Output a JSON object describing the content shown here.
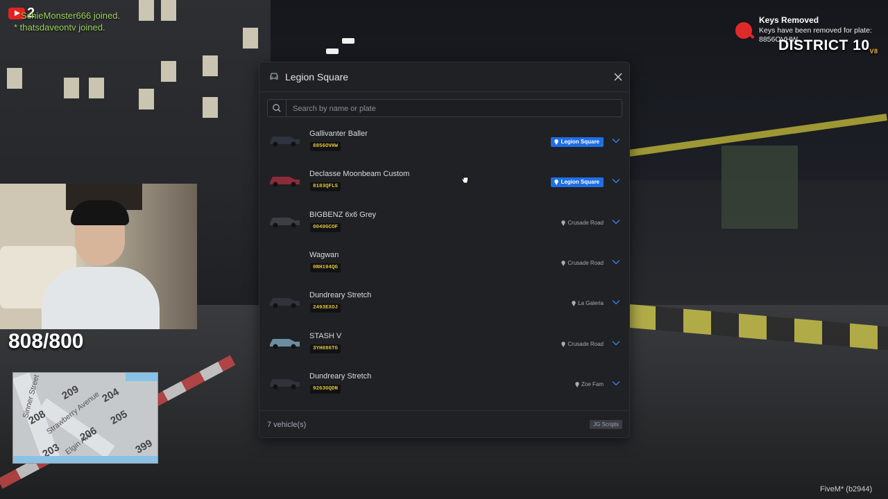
{
  "stream": {
    "youtube_count": "2",
    "chat": [
      "hieMonster666 joined.",
      "* thatsdaveontv joined."
    ],
    "health": "808/800",
    "chat_prefix": "Sc"
  },
  "minimap": {
    "streets": [
      "Strawberry Avenue",
      "Elgin Ave",
      "Sinner Street"
    ],
    "numbers": [
      "209",
      "208",
      "205",
      "399",
      "203",
      "204",
      "206"
    ]
  },
  "notification": {
    "title": "Keys Removed",
    "message": "Keys have been removed for plate: 8856OVHW",
    "icon": "key-icon",
    "accent": "#e02a2a"
  },
  "server": {
    "name": "DISTRICT 10",
    "version": "V8"
  },
  "client": {
    "label": "FiveM* (b2944)"
  },
  "garage": {
    "title": "Legion Square",
    "search_placeholder": "Search by name or plate",
    "accent": "#1f6fe5",
    "vehicles": [
      {
        "name": "Gallivanter Baller",
        "plate": "8856OVHW",
        "location": "Legion Square",
        "here": true,
        "color": "#2d3340"
      },
      {
        "name": "Declasse Moonbeam Custom",
        "plate": "8183QFLS",
        "location": "Legion Square",
        "here": true,
        "color": "#8c2b3a"
      },
      {
        "name": "BIGBENZ 6x6 Grey",
        "plate": "0049GCOF",
        "location": "Crusade Road",
        "here": false,
        "color": "#3b3f44"
      },
      {
        "name": "Wagwan",
        "plate": "0NH194QG",
        "location": "Crusade Road",
        "here": false,
        "color": ""
      },
      {
        "name": "Dundreary Stretch",
        "plate": "2493EXOJ",
        "location": "La Galeria",
        "here": false,
        "color": "#30343a"
      },
      {
        "name": "STASH V",
        "plate": "3YH086TG",
        "location": "Crusade Road",
        "here": false,
        "color": "#6a8ea0"
      },
      {
        "name": "Dundreary Stretch",
        "plate": "9263GQDN",
        "location": "Zoe Fam",
        "here": false,
        "color": "#30343a"
      }
    ],
    "footer_count": "7 vehicle(s)",
    "credit": "JG Scripts"
  }
}
